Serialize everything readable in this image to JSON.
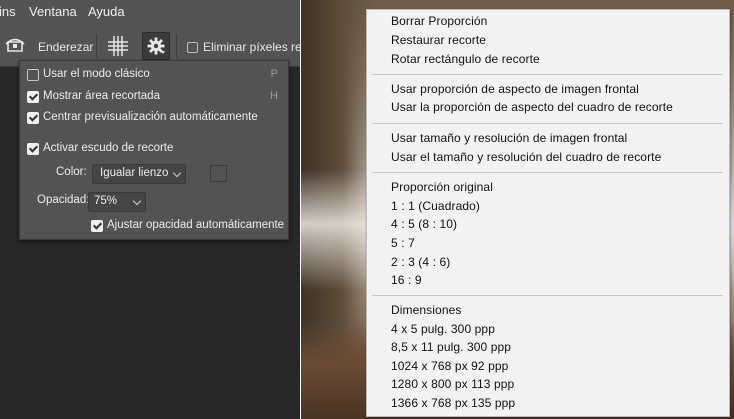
{
  "menubar": {
    "items": [
      "ins",
      "Ventana",
      "Ayuda"
    ]
  },
  "options_bar": {
    "straighten_label": "Enderezar",
    "delete_pixels_label": "Eliminar píxeles reco"
  },
  "crop_settings": {
    "items": [
      {
        "label": "Usar el modo clásico",
        "checked": false,
        "shortcut": "P"
      },
      {
        "label": "Mostrar área recortada",
        "checked": true,
        "shortcut": "H"
      },
      {
        "label": "Centrar previsualización automáticamente",
        "checked": true,
        "shortcut": ""
      },
      {
        "label": "Activar escudo de recorte",
        "checked": true,
        "shortcut": ""
      }
    ],
    "color_label": "Color:",
    "color_value": "Igualar lienzo",
    "opacity_label": "Opacidad:",
    "opacity_value": "75%",
    "auto_opacity_label": "Ajustar opacidad automáticamente",
    "auto_opacity_checked": true
  },
  "context_menu": {
    "group1": [
      "Borrar Proporción",
      "Restaurar recorte",
      "Rotar rectángulo de recorte"
    ],
    "group2": [
      "Usar proporción de aspecto de imagen frontal",
      "Usar la proporción de aspecto del cuadro de recorte"
    ],
    "group3": [
      "Usar tamaño y resolución de imagen frontal",
      "Usar el tamaño y resolución del cuadro de recorte"
    ],
    "group4": [
      "Proporción original",
      "1 : 1 (Cuadrado)",
      "4 : 5 (8 : 10)",
      "5 : 7",
      "2 : 3 (4 : 6)",
      "16 : 9"
    ],
    "group5": [
      "Dimensiones",
      "4 x 5 pulg.  300 ppp",
      "8,5 x 11 pulg.  300 ppp",
      "1024 x 768 px  92 ppp",
      "1280 x 800 px  113 ppp",
      "1366 x 768 px  135 ppp"
    ]
  }
}
